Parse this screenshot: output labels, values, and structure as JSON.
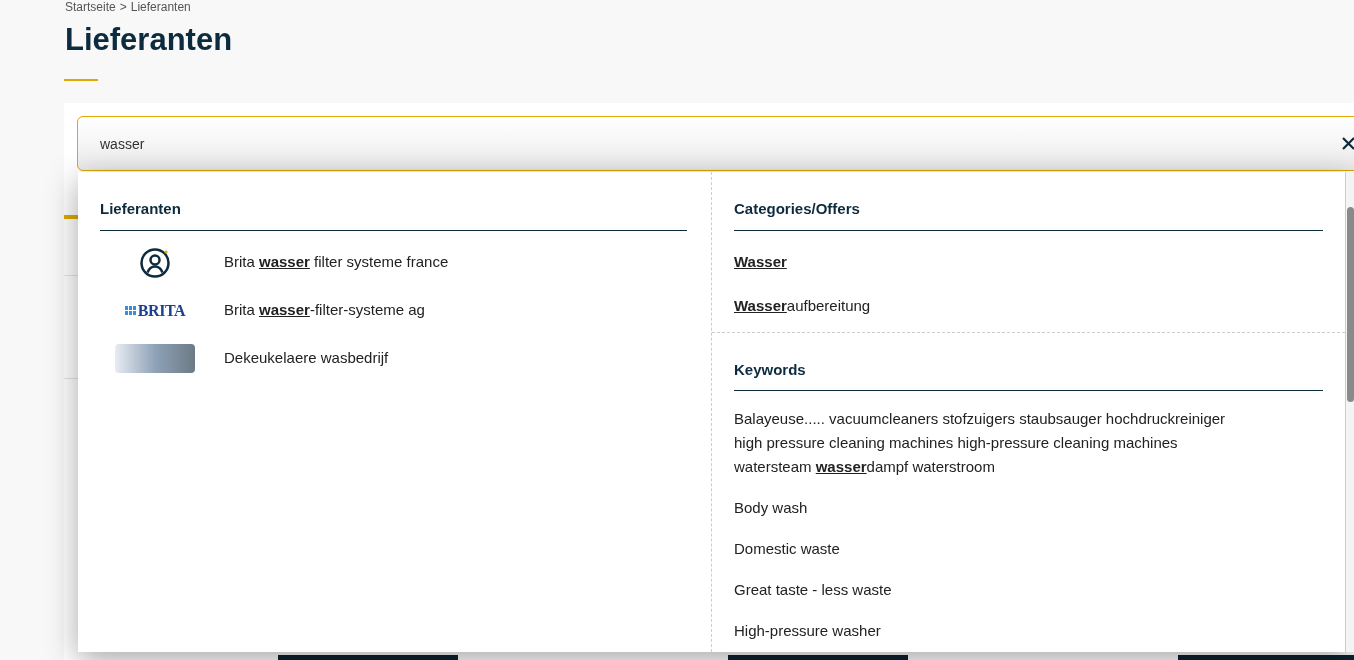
{
  "breadcrumb": [
    "Startseite",
    "Lieferanten"
  ],
  "breadcrumb_separator": ">",
  "title": "Lieferanten",
  "search": {
    "value": "wasser"
  },
  "suppliers": {
    "heading": "Lieferanten",
    "items": [
      {
        "kind": "avatar",
        "name": "Brita **wasser** filter systeme france"
      },
      {
        "kind": "logo",
        "logo_text": "BRITA",
        "name": "Brita **wasser**-filter-systeme ag"
      },
      {
        "kind": "photo",
        "name": "Dekeukelaere wasbedrijf"
      }
    ]
  },
  "categories": {
    "heading": "Categories/Offers",
    "items": [
      "**Wasser**",
      "**Wasser**aufbereitung"
    ]
  },
  "keywords": {
    "heading": "Keywords",
    "items": [
      "Balayeuse..... vacuumcleaners stofzuigers staubsauger hochdruckreiniger high pressure cleaning machines high-pressure cleaning machines watersteam **wasser**dampf waterstroom",
      "Body wash",
      "Domestic waste",
      "Great taste - less waste",
      "High-pressure washer"
    ]
  }
}
